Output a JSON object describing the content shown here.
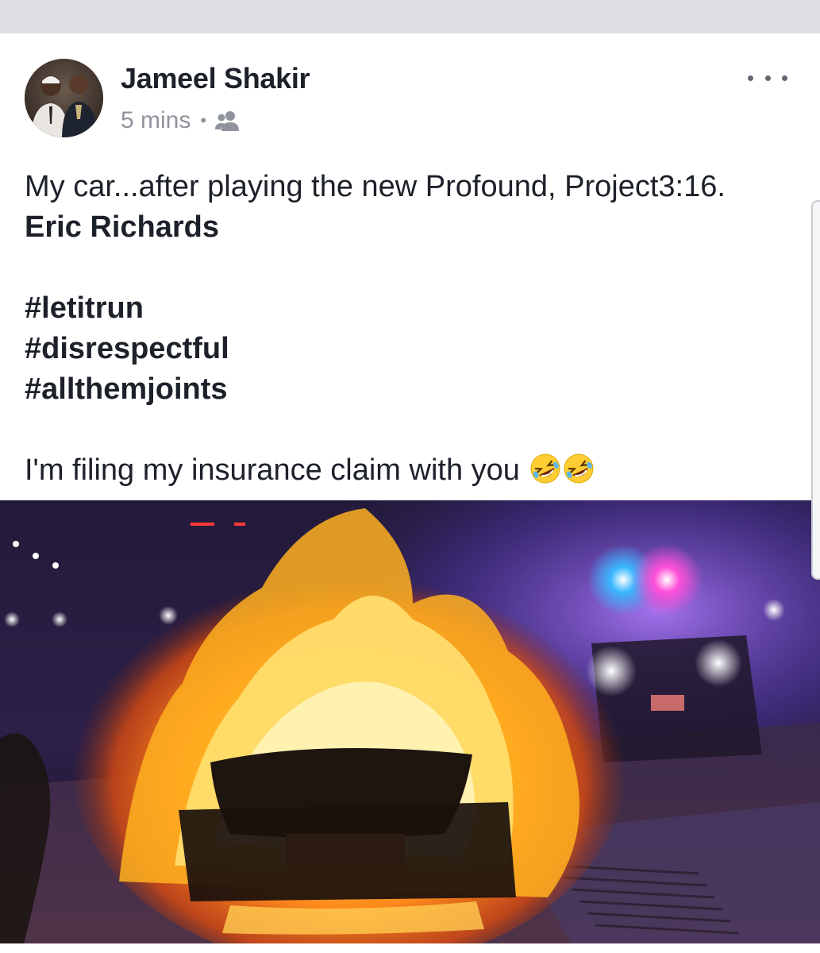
{
  "post": {
    "author": "Jameel Shakir",
    "timestamp": "5 mins",
    "separator": "•",
    "audience_icon": "friends-icon",
    "more_icon": "more-options-icon",
    "text": {
      "line1": "My car...after playing the new Profound, Project3:16.",
      "tag_name": "Eric Richards",
      "hashtags": [
        "#letitrun",
        "#disrespectful",
        "#allthemjoints"
      ],
      "closing": "I'm filing my insurance claim with you",
      "emoji": "rolling-on-the-floor-laughing-emoji"
    }
  },
  "colors": {
    "page_bg": "#dddfe2",
    "card_bg": "#ffffff",
    "primary_text": "#1d2129",
    "secondary_text": "#90949c"
  }
}
